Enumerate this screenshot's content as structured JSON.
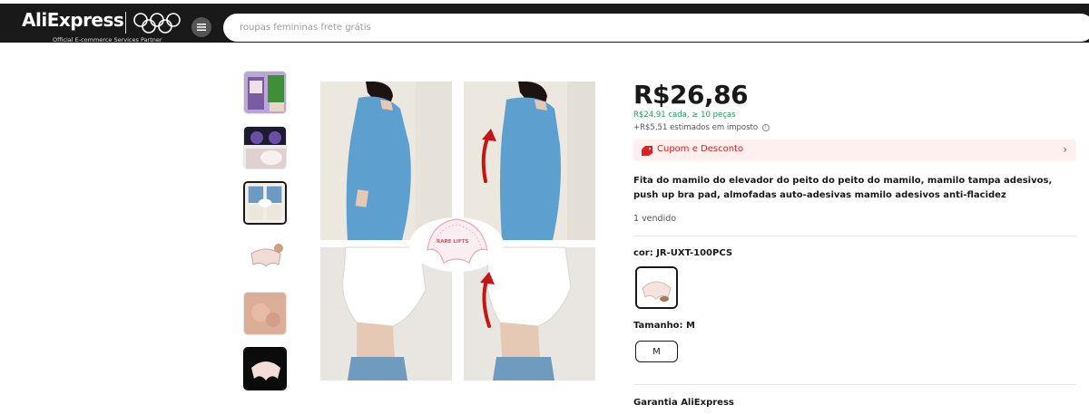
{
  "header": {
    "logo": "AliExpress",
    "logo_sub": "Official E-commerce Services Partner",
    "search_placeholder": "roupas femininas frete grátis"
  },
  "gallery": {
    "thumbnail_count": 6,
    "active_thumbnail_index": 2,
    "pad_label": "RARE LIFTS"
  },
  "product": {
    "price": "R$26,86",
    "bulk_price": "R$24,91 cada, ≥ 10 peças",
    "tax": "+R$5,51 estimados em imposto",
    "coupon_label": "Cupom e Desconto",
    "title": "Fita do mamilo do elevador do peito do peito do mamilo, mamilo tampa adesivos, push up bra pad, almofadas auto-adesivas mamilo adesivos anti-flacidez",
    "sold": "1 vendido",
    "color_label": "cor: JR-UXT-100PCS",
    "size_label": "Tamanho: M",
    "size_option": "M",
    "warranty": "Garantia AliExpress"
  },
  "colors": {
    "accent_red": "#e02020",
    "price_green": "#1f9b52",
    "header_bg": "#191919"
  }
}
